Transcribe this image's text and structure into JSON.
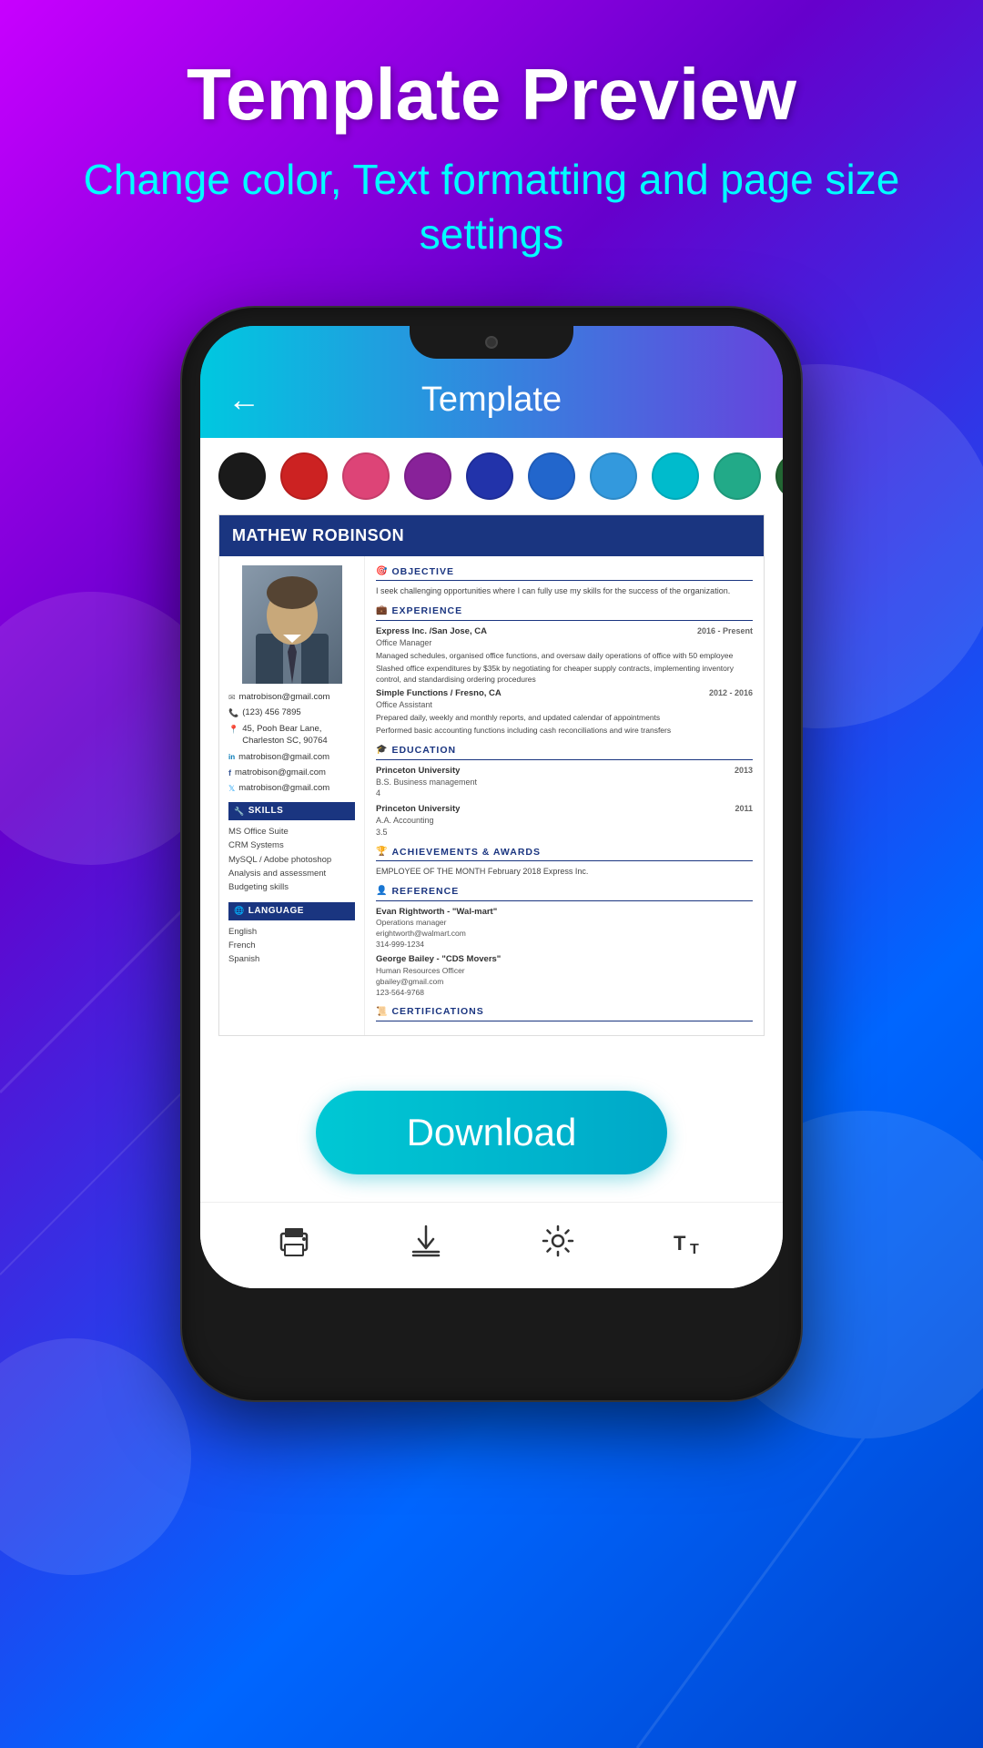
{
  "header": {
    "title": "Template Preview",
    "subtitle": "Change color, Text formatting and page size settings"
  },
  "app": {
    "back_label": "←",
    "title": "Template"
  },
  "colors": [
    {
      "name": "black",
      "hex": "#1a1a1a",
      "selected": false
    },
    {
      "name": "red",
      "hex": "#cc2222",
      "selected": false
    },
    {
      "name": "pink",
      "hex": "#dd4477",
      "selected": false
    },
    {
      "name": "purple",
      "hex": "#882299",
      "selected": false
    },
    {
      "name": "dark-blue",
      "hex": "#2233aa",
      "selected": false
    },
    {
      "name": "blue",
      "hex": "#2266cc",
      "selected": false
    },
    {
      "name": "light-blue",
      "hex": "#3399dd",
      "selected": false
    },
    {
      "name": "cyan",
      "hex": "#00bbcc",
      "selected": false
    },
    {
      "name": "teal",
      "hex": "#22aa88",
      "selected": false
    },
    {
      "name": "green",
      "hex": "#226633",
      "selected": false
    }
  ],
  "resume": {
    "name": "MATHEW ROBINSON",
    "photo_alt": "Profile Photo",
    "contact": {
      "email": "matrobison@gmail.com",
      "phone": "(123) 456 7895",
      "address": "45, Pooh Bear Lane, Charleston SC, 90764",
      "linkedin": "matrobison@gmail.com",
      "facebook": "matrobison@gmail.com",
      "twitter": "matrobison@gmail.com"
    },
    "skills": {
      "label": "SKILLS",
      "items": [
        "MS Office Suite",
        "CRM Systems",
        "MySQL / Adobe photoshop",
        "Analysis and assessment",
        "Budgeting skills"
      ]
    },
    "language": {
      "label": "LANGUAGE",
      "items": [
        "English",
        "French",
        "Spanish"
      ]
    },
    "objective": {
      "label": "OBJECTIVE",
      "text": "I seek challenging opportunities where I can fully use my skills for the success of the organization."
    },
    "experience": {
      "label": "EXPERIENCE",
      "items": [
        {
          "company": "Express Inc. /San Jose, CA",
          "date": "2016 - Present",
          "role": "Office Manager",
          "desc1": "Managed schedules, organised office functions, and oversaw daily operations of office with 50 employee",
          "desc2": "Slashed office expenditures by $35k by negotiating for cheaper supply contracts, implementing inventory control, and standardising ordering procedures"
        },
        {
          "company": "Simple Functions / Fresno, CA",
          "date": "2012 - 2016",
          "role": "Office Assistant",
          "desc1": "Prepared daily, weekly and monthly reports,  and updated calendar of appointments",
          "desc2": "Performed basic accounting functions including cash reconciliations and wire transfers"
        }
      ]
    },
    "education": {
      "label": "EDUCATION",
      "items": [
        {
          "school": "Princeton University",
          "date": "2013",
          "degree": "B.S. Business management",
          "gpa": "4"
        },
        {
          "school": "Princeton University",
          "date": "2011",
          "degree": "A.A. Accounting",
          "gpa": "3.5"
        }
      ]
    },
    "achievements": {
      "label": "ACHIEVEMENTS & AWARDS",
      "text": "EMPLOYEE OF THE MONTH February 2018 Express Inc."
    },
    "reference": {
      "label": "REFERENCE",
      "items": [
        {
          "name": "Evan Rightworth - \"Wal-mart\"",
          "role": "Operations manager",
          "email": "erightworth@walmart.com",
          "phone": "314-999-1234"
        },
        {
          "name": "George Bailey - \"CDS Movers\"",
          "role": "Human Resources Officer",
          "email": "gbailey@gmail.com",
          "phone": "123-564-9768"
        }
      ]
    },
    "certifications": {
      "label": "CERTIFICATIONS"
    }
  },
  "download_button": "Download",
  "bottom_nav": {
    "items": [
      {
        "name": "print",
        "label": "print-icon"
      },
      {
        "name": "download",
        "label": "download-icon"
      },
      {
        "name": "settings",
        "label": "settings-icon"
      },
      {
        "name": "text-size",
        "label": "text-size-icon"
      }
    ]
  }
}
